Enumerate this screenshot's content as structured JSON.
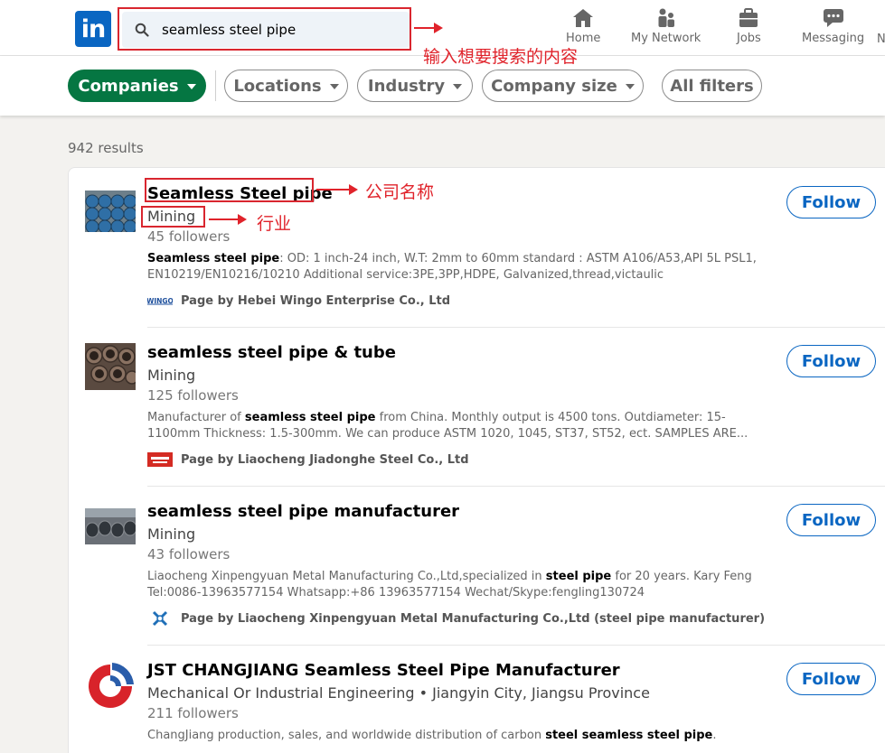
{
  "nav": {
    "logo": "in",
    "search_value": "seamless steel pipe",
    "items": [
      {
        "label": "Home",
        "icon": "home-icon"
      },
      {
        "label": "My Network",
        "icon": "people-icon"
      },
      {
        "label": "Jobs",
        "icon": "briefcase-icon"
      },
      {
        "label": "Messaging",
        "icon": "chat-icon"
      },
      {
        "label": "N"
      }
    ]
  },
  "filters": {
    "companies": "Companies",
    "locations": "Locations",
    "industry": "Industry",
    "company_size": "Company size",
    "all_filters": "All filters"
  },
  "results_count": "942 results",
  "results": [
    {
      "name": "Seamless Steel pipe",
      "industry": "Mining",
      "followers": "45 followers",
      "desc_bold": "Seamless steel pipe",
      "desc_rest": ": OD: 1 inch-24 inch, W.T: 2mm to 60mm standard : ASTM A106/A53,API 5L PSL1, EN10219/EN10216/10210 Additional service:3PE,3PP,HDPE, Galvanized,thread,victaulic",
      "page_by": "Page by Hebei Wingo Enterprise Co., Ltd",
      "mini_logo": "WINGO",
      "follow": "Follow"
    },
    {
      "name": "seamless steel pipe & tube",
      "industry": "Mining",
      "followers": "125 followers",
      "desc_pre": "Manufacturer of ",
      "desc_bold": "seamless steel pipe",
      "desc_rest": " from China. Monthly output is 4500 tons. Outdiameter: 15-1100mm Thickness: 1.5-300mm. We can produce ASTM 1020, 1045, ST37, ST52, ect. SAMPLES ARE...",
      "page_by": "Page by Liaocheng Jiadonghe Steel Co., Ltd",
      "follow": "Follow"
    },
    {
      "name": "seamless steel pipe manufacturer",
      "industry": "Mining",
      "followers": "43 followers",
      "desc_pre": "Liaocheng Xinpengyuan Metal Manufacturing Co.,Ltd,specialized in ",
      "desc_bold": "steel pipe",
      "desc_rest": " for 20 years. Kary Feng Tel:0086-13963577154 Whatsapp:+86 13963577154 Wechat/Skype:fengling130724",
      "page_by": "Page by Liaocheng Xinpengyuan Metal Manufacturing Co.,Ltd (steel pipe manufacturer)",
      "follow": "Follow"
    },
    {
      "name": "JST CHANGJIANG Seamless Steel Pipe Manufacturer",
      "industry": "Mechanical Or Industrial Engineering • Jiangyin City, Jiangsu Province",
      "followers": "211 followers",
      "desc_pre": "ChangJiang production, sales, and worldwide distribution of carbon ",
      "desc_bold": "steel seamless steel pipe",
      "desc_rest": ".",
      "follow": "Follow"
    }
  ],
  "annotations": {
    "search": "输入想要搜索的内容",
    "company_name": "公司名称",
    "industry": "行业"
  },
  "colors": {
    "brand": "#0a66c2",
    "active_filter": "#057642",
    "annotation": "#e0232b"
  }
}
